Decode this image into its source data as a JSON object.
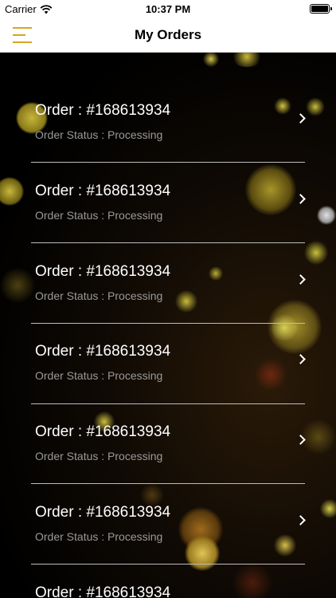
{
  "status_bar": {
    "carrier": "Carrier",
    "time": "10:37 PM"
  },
  "nav": {
    "title": "My Orders"
  },
  "orders": [
    {
      "title": "Order : #168613934",
      "status": "Order Status : Processing"
    },
    {
      "title": "Order : #168613934",
      "status": "Order Status : Processing"
    },
    {
      "title": "Order : #168613934",
      "status": "Order Status : Processing"
    },
    {
      "title": "Order : #168613934",
      "status": "Order Status : Processing"
    },
    {
      "title": "Order : #168613934",
      "status": "Order Status : Processing"
    },
    {
      "title": "Order : #168613934",
      "status": "Order Status : Processing"
    },
    {
      "title": "Order : #168613934",
      "status": ""
    }
  ],
  "colors": {
    "accent": "#d9a521",
    "background": "#000000"
  }
}
